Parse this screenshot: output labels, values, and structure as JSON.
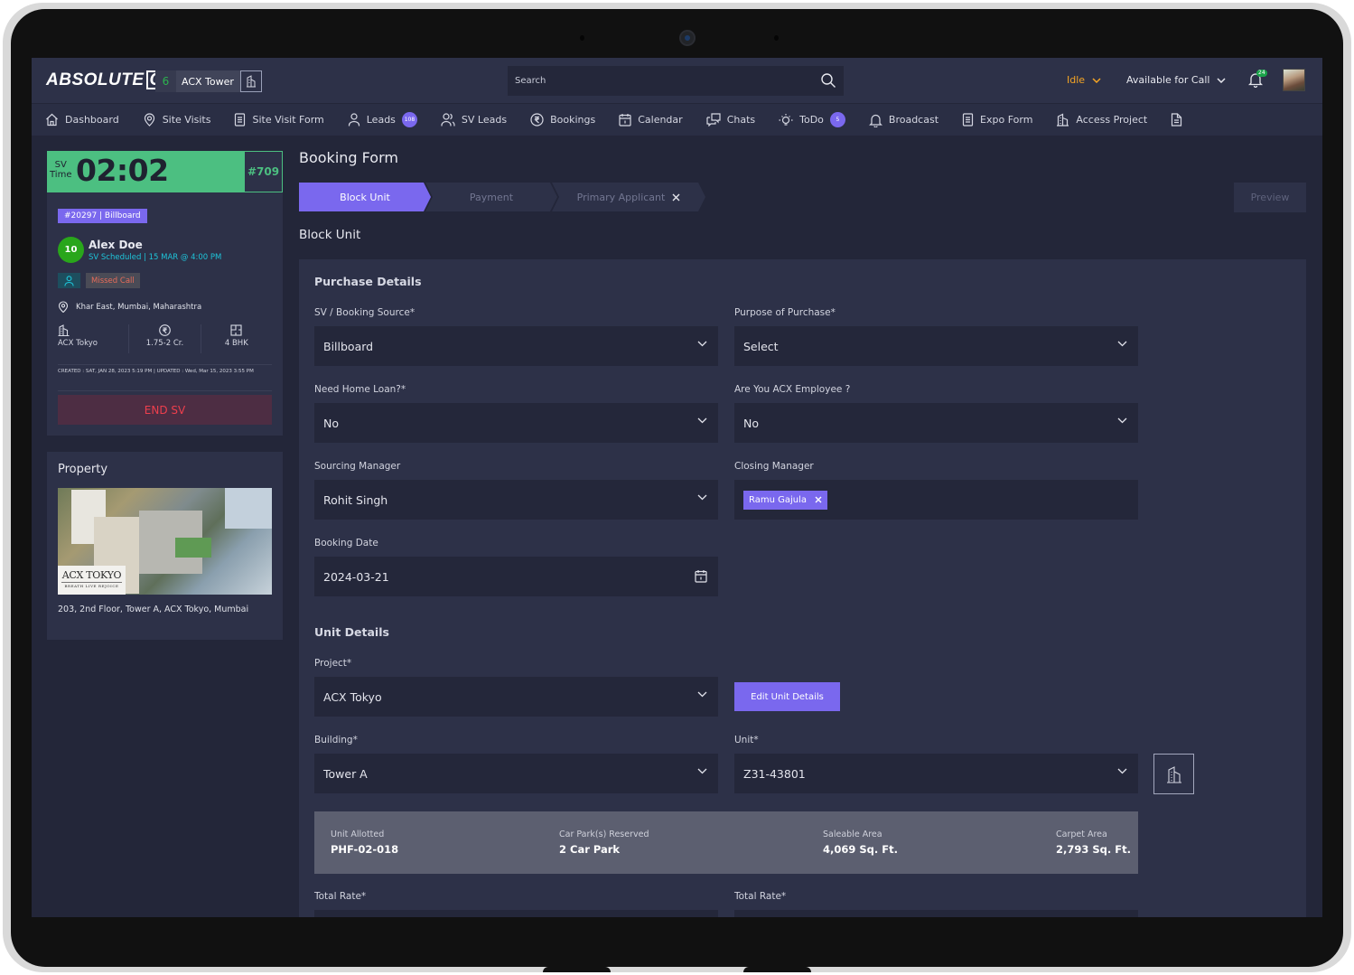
{
  "app": {
    "logo": "ABSOLUTE",
    "logo_suffix": "CX",
    "project_chip": {
      "count": "6",
      "name": "ACX Tower"
    },
    "search": {
      "placeholder": "Search"
    },
    "status_dropdown": "Idle",
    "call_status_dropdown": "Available for Call",
    "notifications_count": "24",
    "colors": {
      "accent": "#7a68ee",
      "timer_green": "#4cbf81",
      "idle_orange": "#f5a524",
      "danger": "#ee3f4d",
      "background": "#232639",
      "panel": "#2d3148"
    }
  },
  "nav": {
    "items": [
      {
        "label": "Dashboard",
        "icon": "home-icon"
      },
      {
        "label": "Site Visits",
        "icon": "location-pin-icon"
      },
      {
        "label": "Site Visit Form",
        "icon": "document-icon"
      },
      {
        "label": "Leads",
        "icon": "user-icon",
        "badge": "108"
      },
      {
        "label": "SV Leads",
        "icon": "users-icon"
      },
      {
        "label": "Bookings",
        "icon": "rupee-icon"
      },
      {
        "label": "Calendar",
        "icon": "calendar-icon"
      },
      {
        "label": "Chats",
        "icon": "chat-icon"
      },
      {
        "label": "ToDo",
        "icon": "bulb-icon",
        "badge": "5"
      },
      {
        "label": "Broadcast",
        "icon": "bell-icon"
      },
      {
        "label": "Expo Form",
        "icon": "document-icon"
      },
      {
        "label": "Access Project",
        "icon": "building-icon"
      }
    ]
  },
  "sv_card": {
    "timer_label_1": "SV",
    "timer_label_2": "Time",
    "timer": "02:02",
    "visit_id": "#709",
    "source_tag": "#20297 | Billboard",
    "score": "10",
    "lead_name": "Alex Doe",
    "lead_status": "SV Scheduled  | 15 MAR @ 4:00 PM",
    "call_status": "Missed Call",
    "location": "Khar East, Mumbai, Maharashtra",
    "stats": [
      {
        "icon": "building-icon",
        "value": "ACX Tokyo"
      },
      {
        "icon": "rupee-icon",
        "value": "1.75-2 Cr."
      },
      {
        "icon": "floorplan-icon",
        "value": "4 BHK"
      }
    ],
    "meta": "CREATED : SAT, JAN 28, 2023  5:19 PM | UPDATED : Wed, Mar 15, 2023  3:55 PM",
    "end_button": "END SV"
  },
  "property": {
    "title": "Property",
    "image_brand": "ACX TOKYO",
    "image_tagline": "BREATH LIVE REJOICE",
    "address": "203, 2nd Floor, Tower A, ACX Tokyo, Mumbai"
  },
  "main": {
    "page_title": "Booking Form",
    "steps": [
      {
        "label": "Block Unit",
        "active": true
      },
      {
        "label": "Payment",
        "active": false
      },
      {
        "label": "Primary Applicant",
        "active": false
      }
    ],
    "preview_button": "Preview",
    "section_title": "Block Unit",
    "purchase_details": {
      "title": "Purchase Details",
      "booking_source": {
        "label": "SV / Booking Source*",
        "value": "Billboard"
      },
      "purpose": {
        "label": "Purpose of Purchase*",
        "value": "Select"
      },
      "home_loan": {
        "label": "Need Home Loan?*",
        "value": "No"
      },
      "acx_employee": {
        "label": "Are You ACX Employee ?",
        "value": "No"
      },
      "sourcing_manager": {
        "label": "Sourcing Manager",
        "value": "Rohit Singh"
      },
      "closing_manager": {
        "label": "Closing Manager",
        "tags": [
          "Ramu Gajula"
        ]
      },
      "booking_date": {
        "label": "Booking Date",
        "value": "2024-03-21"
      }
    },
    "unit_details": {
      "title": "Unit Details",
      "project": {
        "label": "Project*",
        "value": "ACX Tokyo"
      },
      "edit_button": "Edit Unit Details",
      "building": {
        "label": "Building*",
        "value": "Tower A"
      },
      "unit": {
        "label": "Unit*",
        "value": "Z31-43801"
      },
      "summary": [
        {
          "key": "Unit Allotted",
          "value": "PHF-02-018"
        },
        {
          "key": "Car Park(s) Reserved",
          "value": "2 Car Park"
        },
        {
          "key": "Saleable Area",
          "value": "4,069 Sq. Ft."
        },
        {
          "key": "Carpet Area",
          "value": "2,793 Sq. Ft."
        }
      ],
      "total_rate_left": {
        "label": "Total Rate*"
      },
      "total_rate_right": {
        "label": "Total Rate*"
      }
    }
  }
}
